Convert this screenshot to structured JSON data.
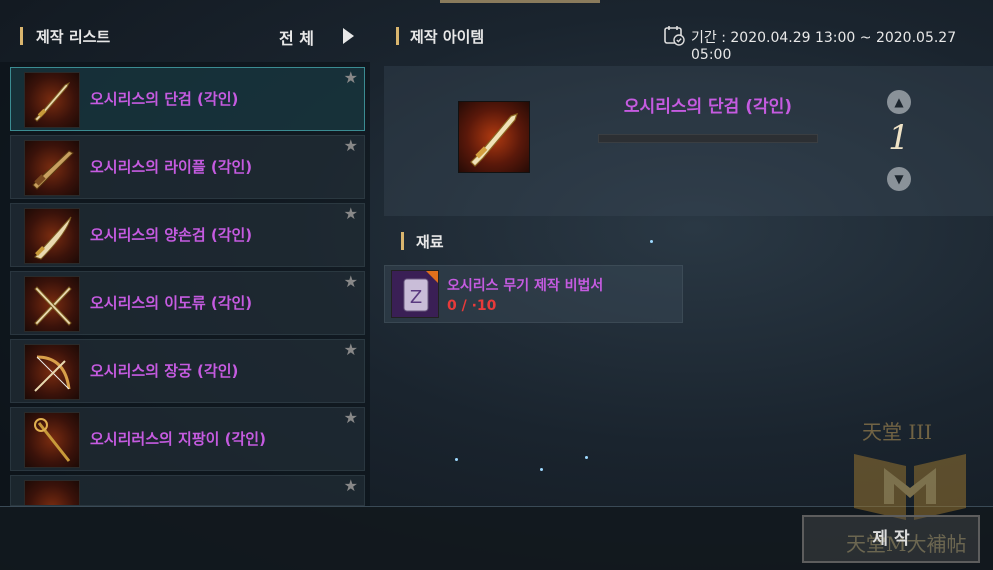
{
  "left_header": {
    "title": "제작 리스트",
    "filter_label": "전 체"
  },
  "right_header": {
    "title": "제작 아이템",
    "period": "기간 : 2020.04.29 13:00 ~ 2020.05.27 05:00"
  },
  "craft_list": [
    {
      "name": "오시리스의 단검 (각인)",
      "selected": true
    },
    {
      "name": "오시리스의 라이플 (각인)",
      "selected": false
    },
    {
      "name": "오시리스의 양손검 (각인)",
      "selected": false
    },
    {
      "name": "오시리스의 이도류 (각인)",
      "selected": false
    },
    {
      "name": "오시리스의 장궁 (각인)",
      "selected": false
    },
    {
      "name": "오시리러스의 지팡이 (각인)",
      "selected": false
    }
  ],
  "selected_item": {
    "name": "오시리스의 단검 (각인)",
    "quantity": "1"
  },
  "materials_header": "재료",
  "materials": [
    {
      "name": "오시리스 무기 제작 비법서",
      "count": "0 / ·10"
    }
  ],
  "craft_button": "제 작",
  "watermark": {
    "top": "天堂 III",
    "bottom": "天堂M大補帖"
  },
  "colors": {
    "item_name": "#c55be0",
    "accent": "#d9b56e",
    "selected_border": "#3b8c92",
    "insufficient": "#e83a3a"
  }
}
